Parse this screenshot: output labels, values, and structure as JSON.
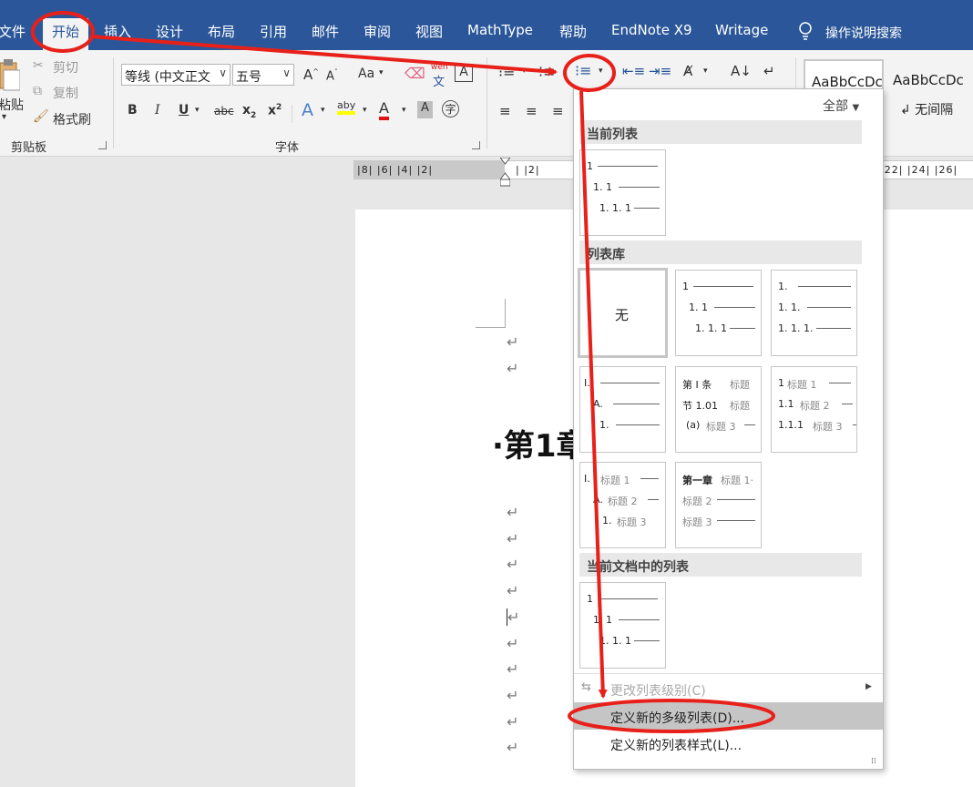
{
  "tabs": {
    "file": "文件",
    "home": "开始",
    "insert": "插入",
    "design": "设计",
    "layout": "布局",
    "references": "引用",
    "mailings": "邮件",
    "review": "审阅",
    "view": "视图",
    "mathtype": "MathType",
    "help": "帮助",
    "endnote": "EndNote X9",
    "writage": "Writage",
    "tell_me": "操作说明搜索"
  },
  "clipboard": {
    "paste": "粘贴",
    "cut": "剪切",
    "copy": "复制",
    "format_painter": "格式刷",
    "group_label": "剪贴板"
  },
  "font": {
    "family": "等线 (中文正文",
    "size": "五号",
    "change_case": "Aa",
    "phonetic": "wén",
    "group_label": "字体",
    "bold": "B",
    "italic": "I",
    "underline": "U",
    "strike": "abc",
    "subscript": "x",
    "sub_mark": "2",
    "superscript": "x",
    "sup_mark": "2",
    "font_color": "A",
    "highlight": "aby"
  },
  "styles": {
    "normal_preview": "AaBbCcDc",
    "nospacing_preview": "AaBbCcDc",
    "nospacing_label": "↲ 无间隔"
  },
  "ruler": {
    "left_numbers": "|8|  |6|  |4|  |2|",
    "mid_numbers": "|  |2|",
    "right_numbers": "|22|  |24|  |26|"
  },
  "document": {
    "heading": "·第1章"
  },
  "multilevel_menu": {
    "filter": "全部",
    "section_current": "当前列表",
    "section_library": "列表库",
    "section_document": "当前文档中的列表",
    "none_label": "无",
    "change_level": "更改列表级别(C)",
    "define_new_list": "定义新的多级列表(D)...",
    "define_new_style": "定义新的列表样式(L)...",
    "current_list": {
      "l1": "1",
      "l2": "1. 1",
      "l3": "1. 1. 1"
    },
    "lib2": {
      "l1": "1",
      "l2": "1. 1",
      "l3": "1. 1. 1"
    },
    "lib3": {
      "l1": "1.",
      "l2": "1. 1.",
      "l3": "1. 1. 1."
    },
    "lib4": {
      "l1": "I.",
      "l2": "A.",
      "l3": "1."
    },
    "lib5": {
      "l1": "第 Ⅰ 条",
      "l1b": "标题",
      "l2": "节 1.01",
      "l2b": "标题",
      "l3": "(a)",
      "l3b": "标题 3"
    },
    "lib6": {
      "l1": "1",
      "l1b": "标题 1",
      "l2": "1.1",
      "l2b": "标题 2",
      "l3": "1.1.1",
      "l3b": "标题 3"
    },
    "lib7": {
      "l1": "I.",
      "l1b": "标题 1",
      "l2": "A.",
      "l2b": "标题 2",
      "l3": "1.",
      "l3b": "标题 3"
    },
    "lib8": {
      "l1": "第一章",
      "l1b": "标题 1·",
      "l2": "",
      "l2b": "标题 2",
      "l3": "",
      "l3b": "标题 3"
    },
    "doc_list": {
      "l1": "1",
      "l2": "1. 1",
      "l3": "1. 1. 1"
    }
  },
  "colors": {
    "ribbon_blue": "#2b579a",
    "annotation_red": "#e8201a",
    "highlight_yellow": "#ffff00",
    "font_red": "#e01010"
  }
}
